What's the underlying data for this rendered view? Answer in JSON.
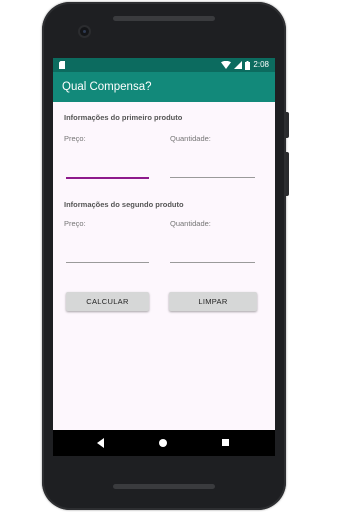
{
  "app": {
    "title": "Qual Compensa?"
  },
  "status_bar": {
    "time": "2:08"
  },
  "product1": {
    "section_title": "Informações do primeiro produto",
    "price_label": "Preço:",
    "price_value": "",
    "quantity_label": "Quantidade:",
    "quantity_value": ""
  },
  "product2": {
    "section_title": "Informações do segundo produto",
    "price_label": "Preço:",
    "price_value": "",
    "quantity_label": "Quantidade:",
    "quantity_value": ""
  },
  "buttons": {
    "calculate": "CALCULAR",
    "clear": "LIMPAR"
  },
  "colors": {
    "status_bar": "#0c6b5f",
    "app_bar": "#12897a",
    "accent": "#8e1a8c",
    "background": "#fdf7fd"
  },
  "icons": {
    "status": [
      "sd-card-icon",
      "wifi-icon",
      "cell-signal-icon",
      "battery-icon"
    ],
    "navigation": [
      "back-icon",
      "home-icon",
      "recents-icon"
    ]
  }
}
